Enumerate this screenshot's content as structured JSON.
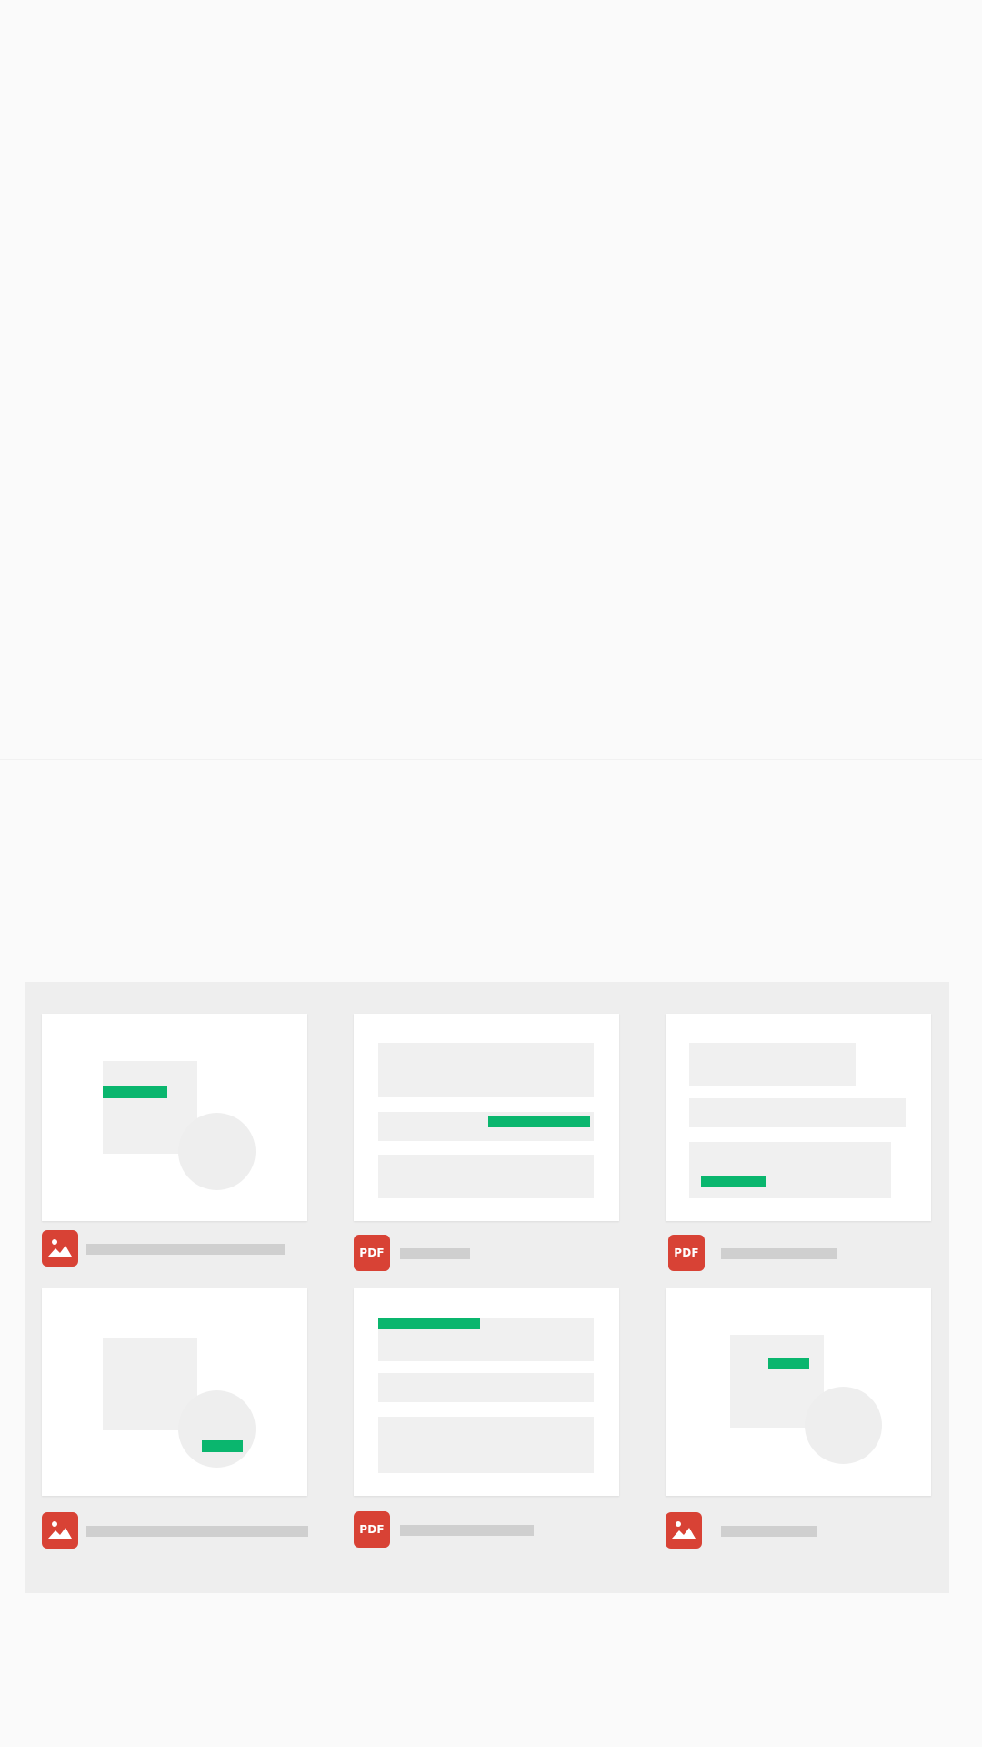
{
  "screen": {
    "background": "#fafafa",
    "panel_background": "#eeeeee",
    "accent_color": "#0ab66e",
    "file_icon_color": "#d84235"
  },
  "files": [
    {
      "type": "image",
      "icon": "image-icon"
    },
    {
      "type": "pdf",
      "icon": "pdf-icon",
      "label": "PDF"
    },
    {
      "type": "pdf",
      "icon": "pdf-icon",
      "label": "PDF"
    },
    {
      "type": "image",
      "icon": "image-icon"
    },
    {
      "type": "pdf",
      "icon": "pdf-icon",
      "label": "PDF"
    },
    {
      "type": "image",
      "icon": "image-icon"
    }
  ]
}
